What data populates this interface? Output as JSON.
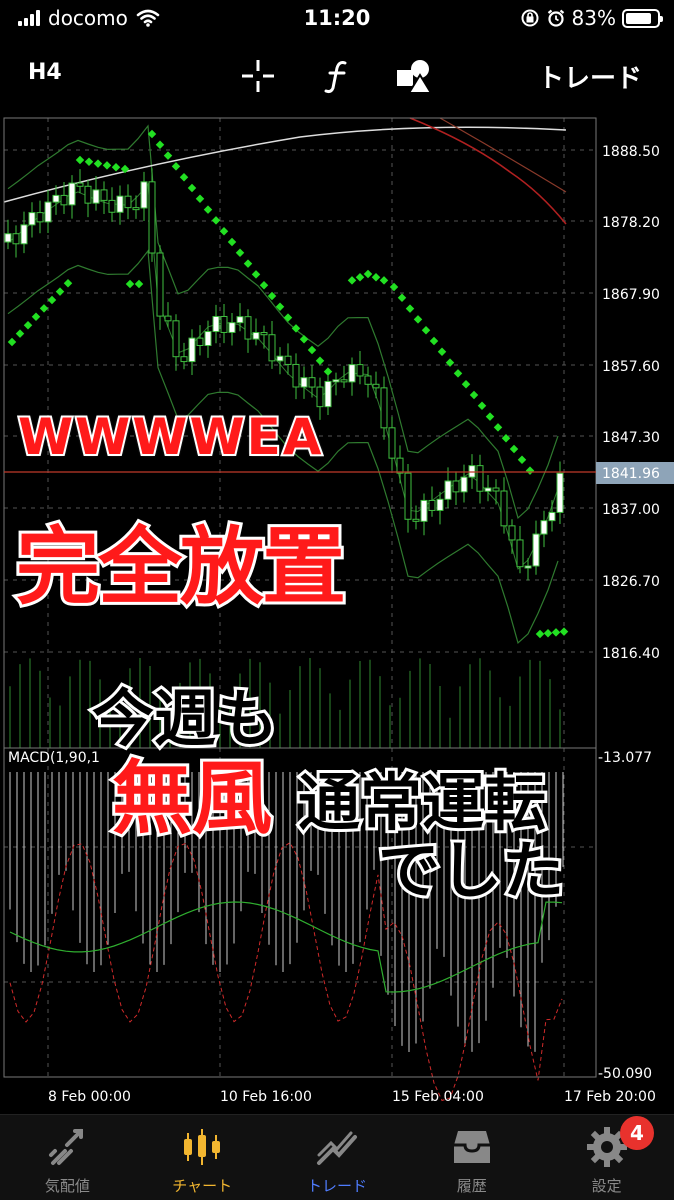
{
  "status_bar": {
    "carrier": "docomo",
    "time": "11:20",
    "battery": "83%",
    "battery_level": 0.83,
    "icons": [
      "signal-icon",
      "wifi-icon",
      "orientation-lock-icon",
      "alarm-icon",
      "battery-icon"
    ]
  },
  "toolbar": {
    "timeframe": "H4",
    "icons": [
      "crosshair-icon",
      "function-icon",
      "objects-icon"
    ],
    "trade_label": "トレード"
  },
  "chart": {
    "price_labels": [
      "1888.50",
      "1878.20",
      "1867.90",
      "1857.60",
      "1847.30",
      "1841.96",
      "1837.00",
      "1826.70",
      "1816.40"
    ],
    "current_price": "1841.96",
    "macd_label": "MACD(1,90,1",
    "macd_axis": [
      "-13.077",
      "-50.090"
    ],
    "time_labels": [
      "8 Feb 00:00",
      "10 Feb 16:00",
      "15 Feb 04:00",
      "17 Feb 20:00"
    ],
    "colors": {
      "bull": "#ffffff",
      "bear": "#000000",
      "wick": "#3fbf3f",
      "sar": "#22e022",
      "ma_white": "#dddddd",
      "ma_red": "#b02020",
      "bands": "#2f7a2f",
      "price_line": "#c0392b",
      "grid": "#555555"
    }
  },
  "overlay": {
    "brand": "WWWWEA",
    "headline": "完全放置",
    "line1": "今週も",
    "mufu": "無風",
    "line2": "通常運転",
    "line3": "でした"
  },
  "tabs": [
    {
      "label": "気配値",
      "icon": "quotes-icon"
    },
    {
      "label": "チャート",
      "icon": "chart-icon"
    },
    {
      "label": "トレード",
      "icon": "trade-icon"
    },
    {
      "label": "履歴",
      "icon": "history-icon"
    },
    {
      "label": "設定",
      "icon": "settings-icon",
      "badge": "4"
    }
  ]
}
